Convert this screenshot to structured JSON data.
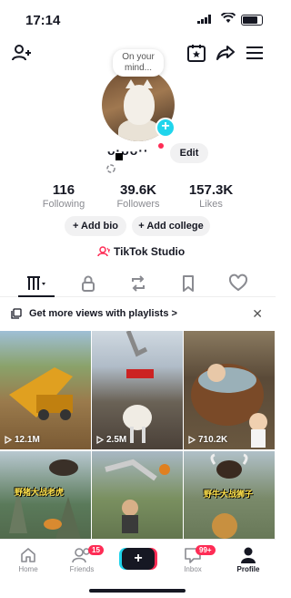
{
  "status_bar": {
    "time": "17:14"
  },
  "bubble": {
    "text": "On your mind..."
  },
  "profile": {
    "username_obscured": "ᴗ·ᴗᴗ··",
    "edit_label": "Edit"
  },
  "stats": [
    {
      "value": "116",
      "label": "Following"
    },
    {
      "value": "39.6K",
      "label": "Followers"
    },
    {
      "value": "157.3K",
      "label": "Likes"
    }
  ],
  "actions": {
    "add_bio": "+ Add bio",
    "add_college": "+ Add college"
  },
  "studio": {
    "label": "TikTok Studio"
  },
  "banner": {
    "text": "Get more views with playlists >"
  },
  "videos": [
    {
      "views": "12.1M",
      "caption": ""
    },
    {
      "views": "2.5M",
      "caption": ""
    },
    {
      "views": "710.2K",
      "caption": ""
    },
    {
      "views": "",
      "caption": "野猪大战老虎"
    },
    {
      "views": "",
      "caption": ""
    },
    {
      "views": "",
      "caption": "野牛大战狮子"
    }
  ],
  "nav": {
    "home": "Home",
    "friends": "Friends",
    "friends_badge": "15",
    "create": "+",
    "inbox": "Inbox",
    "inbox_badge": "99+",
    "profile": "Profile"
  },
  "colors": {
    "accent_red": "#fe2c55",
    "accent_cyan": "#20d5ec"
  }
}
